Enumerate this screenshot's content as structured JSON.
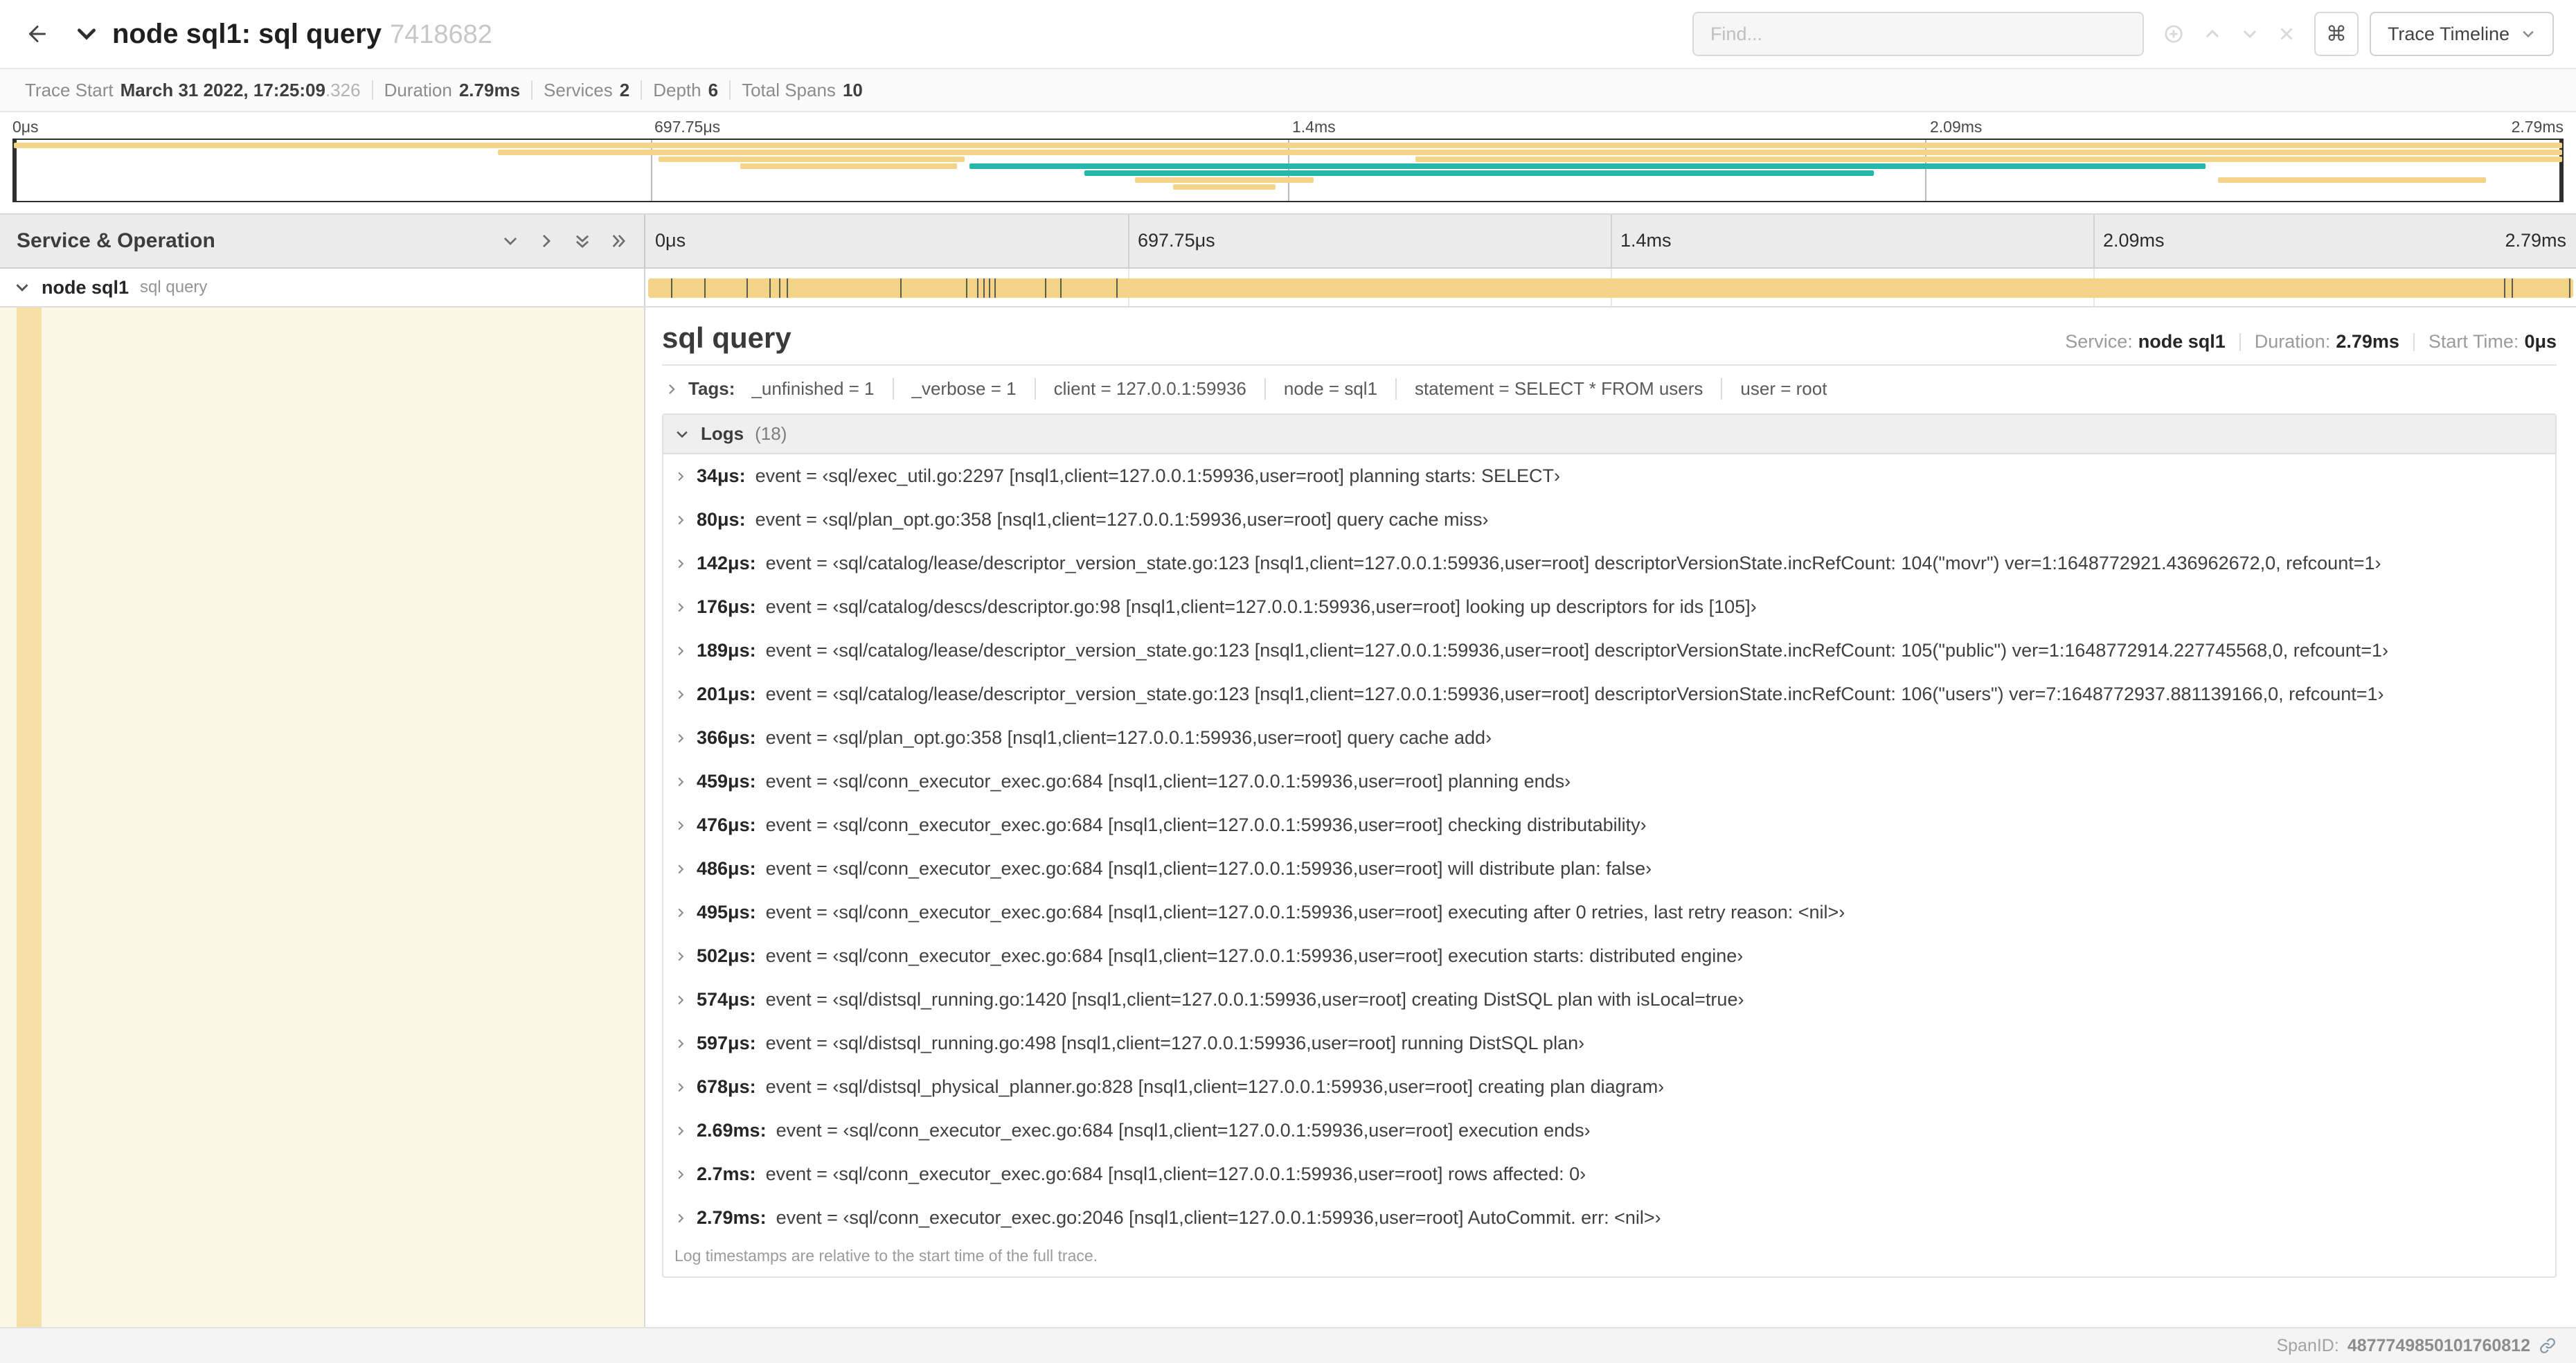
{
  "colors": {
    "tan": "#f3d488",
    "teal": "#27b6aa",
    "cream": "#fdf7e8",
    "stripe": "#f7dfa6"
  },
  "icons": {
    "command": "⌘"
  },
  "header": {
    "title": "node sql1: sql query",
    "trace_id": "7418682",
    "find_placeholder": "Find...",
    "view_button": "Trace Timeline"
  },
  "summary": {
    "items": [
      {
        "label": "Trace Start",
        "value": "March 31 2022, 17:25:09",
        "suffix": ".326"
      },
      {
        "label": "Duration",
        "value": "2.79ms",
        "suffix": ""
      },
      {
        "label": "Services",
        "value": "2",
        "suffix": ""
      },
      {
        "label": "Depth",
        "value": "6",
        "suffix": ""
      },
      {
        "label": "Total Spans",
        "value": "10",
        "suffix": ""
      }
    ]
  },
  "minimap": {
    "ticks": [
      "0μs",
      "697.75μs",
      "1.4ms",
      "2.09ms",
      "2.79ms"
    ],
    "bars": [
      {
        "t": 2,
        "l": 0,
        "w": 100,
        "c": "tan"
      },
      {
        "t": 7,
        "l": 19,
        "w": 81,
        "c": "tan"
      },
      {
        "t": 12,
        "l": 25.3,
        "w": 12,
        "c": "tan"
      },
      {
        "t": 12,
        "l": 55,
        "w": 45,
        "c": "tan"
      },
      {
        "t": 17,
        "l": 28.5,
        "w": 8.5,
        "c": "tan"
      },
      {
        "t": 17,
        "l": 37.5,
        "w": 48.5,
        "c": "teal"
      },
      {
        "t": 22,
        "l": 42,
        "w": 31,
        "c": "teal"
      },
      {
        "t": 27,
        "l": 44,
        "w": 7,
        "c": "tan"
      },
      {
        "t": 27,
        "l": 86.5,
        "w": 10.5,
        "c": "tan"
      },
      {
        "t": 32,
        "l": 45.5,
        "w": 4,
        "c": "tan"
      }
    ]
  },
  "timeline": {
    "left_header": "Service & Operation",
    "ticks": [
      "0μs",
      "697.75μs",
      "1.4ms",
      "2.09ms",
      "2.79ms"
    ],
    "span": {
      "service": "node sql1",
      "operation": "sql query",
      "ticks": [
        1.2,
        2.9,
        5.1,
        6.3,
        6.8,
        7.2,
        13.1,
        16.5,
        17.1,
        17.4,
        17.7,
        18.0,
        20.6,
        21.4,
        24.3,
        96.4,
        96.8,
        99.8
      ]
    }
  },
  "detail": {
    "title": "sql query",
    "service_label": "Service:",
    "service": "node sql1",
    "duration_label": "Duration:",
    "duration": "2.79ms",
    "start_label": "Start Time:",
    "start": "0μs",
    "tags_label": "Tags:",
    "tags": [
      "_unfinished = 1",
      "_verbose = 1",
      "client = 127.0.0.1:59936",
      "node = sql1",
      "statement = SELECT * FROM users",
      "user = root"
    ],
    "logs_label": "Logs",
    "logs_count": "(18)",
    "logs": [
      {
        "time": "34μs:",
        "text": "event = ‹sql/exec_util.go:2297 [nsql1,client=127.0.0.1:59936,user=root] planning starts: SELECT›"
      },
      {
        "time": "80μs:",
        "text": "event = ‹sql/plan_opt.go:358 [nsql1,client=127.0.0.1:59936,user=root] query cache miss›"
      },
      {
        "time": "142μs:",
        "text": "event = ‹sql/catalog/lease/descriptor_version_state.go:123 [nsql1,client=127.0.0.1:59936,user=root] descriptorVersionState.incRefCount: 104(\"movr\") ver=1:1648772921.436962672,0, refcount=1›"
      },
      {
        "time": "176μs:",
        "text": "event = ‹sql/catalog/descs/descriptor.go:98 [nsql1,client=127.0.0.1:59936,user=root] looking up descriptors for ids [105]›"
      },
      {
        "time": "189μs:",
        "text": "event = ‹sql/catalog/lease/descriptor_version_state.go:123 [nsql1,client=127.0.0.1:59936,user=root] descriptorVersionState.incRefCount: 105(\"public\") ver=1:1648772914.227745568,0, refcount=1›"
      },
      {
        "time": "201μs:",
        "text": "event = ‹sql/catalog/lease/descriptor_version_state.go:123 [nsql1,client=127.0.0.1:59936,user=root] descriptorVersionState.incRefCount: 106(\"users\") ver=7:1648772937.881139166,0, refcount=1›"
      },
      {
        "time": "366μs:",
        "text": "event = ‹sql/plan_opt.go:358 [nsql1,client=127.0.0.1:59936,user=root] query cache add›"
      },
      {
        "time": "459μs:",
        "text": "event = ‹sql/conn_executor_exec.go:684 [nsql1,client=127.0.0.1:59936,user=root] planning ends›"
      },
      {
        "time": "476μs:",
        "text": "event = ‹sql/conn_executor_exec.go:684 [nsql1,client=127.0.0.1:59936,user=root] checking distributability›"
      },
      {
        "time": "486μs:",
        "text": "event = ‹sql/conn_executor_exec.go:684 [nsql1,client=127.0.0.1:59936,user=root] will distribute plan: false›"
      },
      {
        "time": "495μs:",
        "text": "event = ‹sql/conn_executor_exec.go:684 [nsql1,client=127.0.0.1:59936,user=root] executing after 0 retries, last retry reason: <nil>›"
      },
      {
        "time": "502μs:",
        "text": "event = ‹sql/conn_executor_exec.go:684 [nsql1,client=127.0.0.1:59936,user=root] execution starts: distributed engine›"
      },
      {
        "time": "574μs:",
        "text": "event = ‹sql/distsql_running.go:1420 [nsql1,client=127.0.0.1:59936,user=root] creating DistSQL plan with isLocal=true›"
      },
      {
        "time": "597μs:",
        "text": "event = ‹sql/distsql_running.go:498 [nsql1,client=127.0.0.1:59936,user=root] running DistSQL plan›"
      },
      {
        "time": "678μs:",
        "text": "event = ‹sql/distsql_physical_planner.go:828 [nsql1,client=127.0.0.1:59936,user=root] creating plan diagram›"
      },
      {
        "time": "2.69ms:",
        "text": "event = ‹sql/conn_executor_exec.go:684 [nsql1,client=127.0.0.1:59936,user=root] execution ends›"
      },
      {
        "time": "2.7ms:",
        "text": "event = ‹sql/conn_executor_exec.go:684 [nsql1,client=127.0.0.1:59936,user=root] rows affected: 0›"
      },
      {
        "time": "2.79ms:",
        "text": "event = ‹sql/conn_executor_exec.go:2046 [nsql1,client=127.0.0.1:59936,user=root] AutoCommit. err: <nil>›"
      }
    ],
    "logs_note": "Log timestamps are relative to the start time of the full trace."
  },
  "footer": {
    "span_id_label": "SpanID:",
    "span_id": "4877749850101760812"
  }
}
